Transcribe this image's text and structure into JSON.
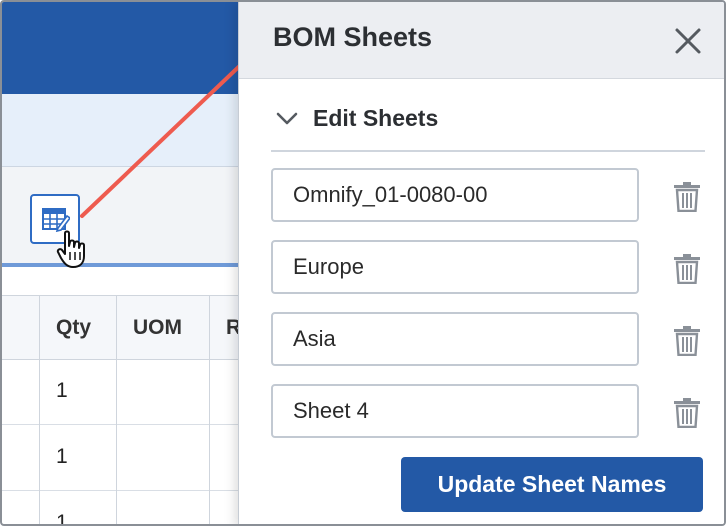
{
  "colors": {
    "brand_blue": "#2359a6",
    "annotation_arrow": "#ee5b4f",
    "panel_header_bg": "#eceef2"
  },
  "grid": {
    "columns": [
      "Qty",
      "UOM",
      "R"
    ],
    "rows": [
      {
        "qty": "1"
      },
      {
        "qty": "1"
      },
      {
        "qty": "1"
      }
    ]
  },
  "toolbar": {
    "edit_sheets_icon": "table-edit-icon"
  },
  "panel": {
    "title": "BOM Sheets",
    "close_icon": "close-icon",
    "section": {
      "label": "Edit Sheets",
      "expanded": true,
      "icon": "chevron-down-icon"
    },
    "sheets": [
      {
        "name": "Omnify_01-0080-00",
        "delete_icon": "trash-icon"
      },
      {
        "name": "Europe",
        "delete_icon": "trash-icon"
      },
      {
        "name": "Asia",
        "delete_icon": "trash-icon"
      },
      {
        "name": "Sheet 4",
        "delete_icon": "trash-icon"
      }
    ],
    "update_button": "Update Sheet Names"
  }
}
